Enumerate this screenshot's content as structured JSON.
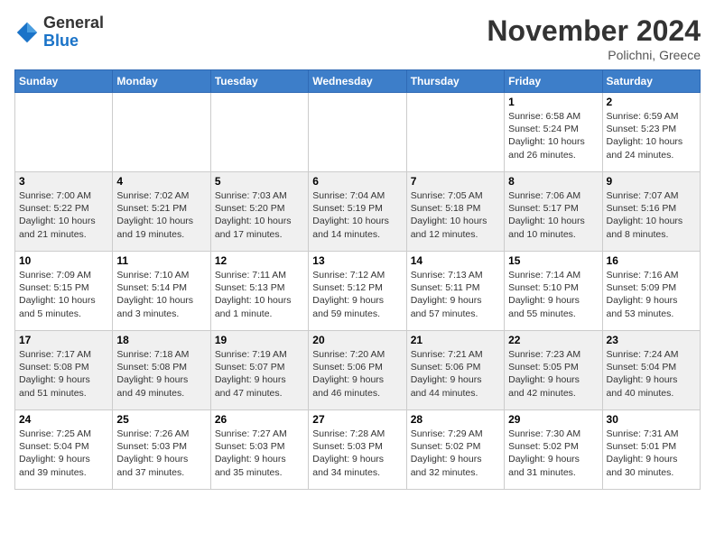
{
  "header": {
    "logo_line1": "General",
    "logo_line2": "Blue",
    "month": "November 2024",
    "location": "Polichni, Greece"
  },
  "weekdays": [
    "Sunday",
    "Monday",
    "Tuesday",
    "Wednesday",
    "Thursday",
    "Friday",
    "Saturday"
  ],
  "weeks": [
    [
      {
        "day": "",
        "info": ""
      },
      {
        "day": "",
        "info": ""
      },
      {
        "day": "",
        "info": ""
      },
      {
        "day": "",
        "info": ""
      },
      {
        "day": "",
        "info": ""
      },
      {
        "day": "1",
        "info": "Sunrise: 6:58 AM\nSunset: 5:24 PM\nDaylight: 10 hours\nand 26 minutes."
      },
      {
        "day": "2",
        "info": "Sunrise: 6:59 AM\nSunset: 5:23 PM\nDaylight: 10 hours\nand 24 minutes."
      }
    ],
    [
      {
        "day": "3",
        "info": "Sunrise: 7:00 AM\nSunset: 5:22 PM\nDaylight: 10 hours\nand 21 minutes."
      },
      {
        "day": "4",
        "info": "Sunrise: 7:02 AM\nSunset: 5:21 PM\nDaylight: 10 hours\nand 19 minutes."
      },
      {
        "day": "5",
        "info": "Sunrise: 7:03 AM\nSunset: 5:20 PM\nDaylight: 10 hours\nand 17 minutes."
      },
      {
        "day": "6",
        "info": "Sunrise: 7:04 AM\nSunset: 5:19 PM\nDaylight: 10 hours\nand 14 minutes."
      },
      {
        "day": "7",
        "info": "Sunrise: 7:05 AM\nSunset: 5:18 PM\nDaylight: 10 hours\nand 12 minutes."
      },
      {
        "day": "8",
        "info": "Sunrise: 7:06 AM\nSunset: 5:17 PM\nDaylight: 10 hours\nand 10 minutes."
      },
      {
        "day": "9",
        "info": "Sunrise: 7:07 AM\nSunset: 5:16 PM\nDaylight: 10 hours\nand 8 minutes."
      }
    ],
    [
      {
        "day": "10",
        "info": "Sunrise: 7:09 AM\nSunset: 5:15 PM\nDaylight: 10 hours\nand 5 minutes."
      },
      {
        "day": "11",
        "info": "Sunrise: 7:10 AM\nSunset: 5:14 PM\nDaylight: 10 hours\nand 3 minutes."
      },
      {
        "day": "12",
        "info": "Sunrise: 7:11 AM\nSunset: 5:13 PM\nDaylight: 10 hours\nand 1 minute."
      },
      {
        "day": "13",
        "info": "Sunrise: 7:12 AM\nSunset: 5:12 PM\nDaylight: 9 hours\nand 59 minutes."
      },
      {
        "day": "14",
        "info": "Sunrise: 7:13 AM\nSunset: 5:11 PM\nDaylight: 9 hours\nand 57 minutes."
      },
      {
        "day": "15",
        "info": "Sunrise: 7:14 AM\nSunset: 5:10 PM\nDaylight: 9 hours\nand 55 minutes."
      },
      {
        "day": "16",
        "info": "Sunrise: 7:16 AM\nSunset: 5:09 PM\nDaylight: 9 hours\nand 53 minutes."
      }
    ],
    [
      {
        "day": "17",
        "info": "Sunrise: 7:17 AM\nSunset: 5:08 PM\nDaylight: 9 hours\nand 51 minutes."
      },
      {
        "day": "18",
        "info": "Sunrise: 7:18 AM\nSunset: 5:08 PM\nDaylight: 9 hours\nand 49 minutes."
      },
      {
        "day": "19",
        "info": "Sunrise: 7:19 AM\nSunset: 5:07 PM\nDaylight: 9 hours\nand 47 minutes."
      },
      {
        "day": "20",
        "info": "Sunrise: 7:20 AM\nSunset: 5:06 PM\nDaylight: 9 hours\nand 46 minutes."
      },
      {
        "day": "21",
        "info": "Sunrise: 7:21 AM\nSunset: 5:06 PM\nDaylight: 9 hours\nand 44 minutes."
      },
      {
        "day": "22",
        "info": "Sunrise: 7:23 AM\nSunset: 5:05 PM\nDaylight: 9 hours\nand 42 minutes."
      },
      {
        "day": "23",
        "info": "Sunrise: 7:24 AM\nSunset: 5:04 PM\nDaylight: 9 hours\nand 40 minutes."
      }
    ],
    [
      {
        "day": "24",
        "info": "Sunrise: 7:25 AM\nSunset: 5:04 PM\nDaylight: 9 hours\nand 39 minutes."
      },
      {
        "day": "25",
        "info": "Sunrise: 7:26 AM\nSunset: 5:03 PM\nDaylight: 9 hours\nand 37 minutes."
      },
      {
        "day": "26",
        "info": "Sunrise: 7:27 AM\nSunset: 5:03 PM\nDaylight: 9 hours\nand 35 minutes."
      },
      {
        "day": "27",
        "info": "Sunrise: 7:28 AM\nSunset: 5:03 PM\nDaylight: 9 hours\nand 34 minutes."
      },
      {
        "day": "28",
        "info": "Sunrise: 7:29 AM\nSunset: 5:02 PM\nDaylight: 9 hours\nand 32 minutes."
      },
      {
        "day": "29",
        "info": "Sunrise: 7:30 AM\nSunset: 5:02 PM\nDaylight: 9 hours\nand 31 minutes."
      },
      {
        "day": "30",
        "info": "Sunrise: 7:31 AM\nSunset: 5:01 PM\nDaylight: 9 hours\nand 30 minutes."
      }
    ]
  ]
}
